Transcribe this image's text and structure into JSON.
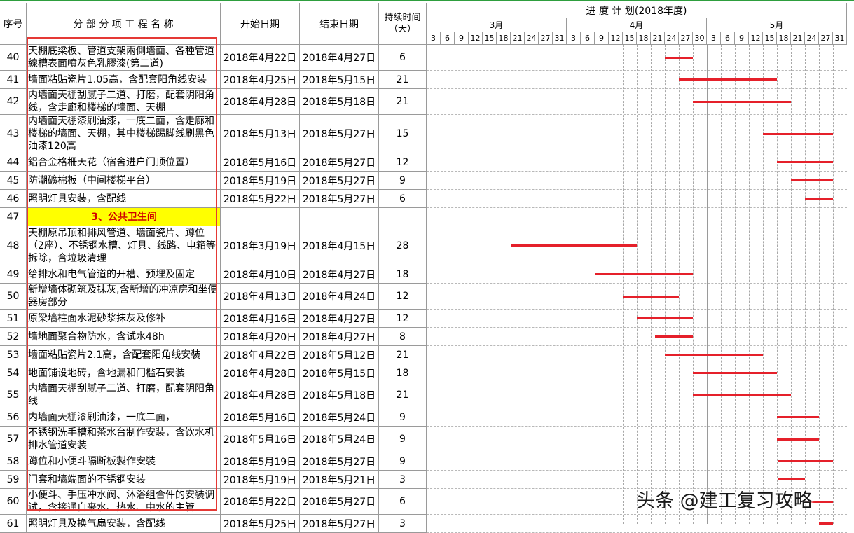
{
  "header": {
    "col_no": "序号",
    "col_name": "分 部 分 项 工 程 名 称",
    "col_start": "开始日期",
    "col_end": "结束日期",
    "col_duration": "持续时间（天）",
    "plan_title": "进 度 计 划(2018年度)",
    "months": [
      "3月",
      "4月",
      "5月"
    ],
    "days": [
      "3",
      "6",
      "9",
      "12",
      "15",
      "18",
      "21",
      "24",
      "27",
      "31",
      "3",
      "6",
      "9",
      "12",
      "15",
      "18",
      "21",
      "24",
      "27",
      "30",
      "3",
      "6",
      "9",
      "12",
      "15",
      "18",
      "21",
      "24",
      "27",
      "31"
    ]
  },
  "rows": [
    {
      "no": "40",
      "name": "天棚底梁板、管道支架兩側墻面、各種管道線槽表面噴灰色乳膠漆(第二道)",
      "start": "2018年4月22日",
      "end": "2018年4月27日",
      "duration": "6",
      "bar": [
        17,
        19
      ]
    },
    {
      "no": "41",
      "name": "墙面粘贴瓷片1.05高，含配套阳角线安装",
      "start": "2018年4月25日",
      "end": "2018年5月15日",
      "duration": "21",
      "bar": [
        18,
        25
      ]
    },
    {
      "no": "42",
      "name": "内墙面天棚刮腻子二道、打磨，配套阴阳角线，含走廊和楼梯的墙面、天棚",
      "start": "2018年4月28日",
      "end": "2018年5月18日",
      "duration": "21",
      "bar": [
        19,
        26
      ]
    },
    {
      "no": "43",
      "name": "内墙面天棚漆刷油漆，一底二面，含走廊和楼梯的墙面、天棚，其中楼梯踢脚线刷黑色油漆120高",
      "start": "2018年5月13日",
      "end": "2018年5月27日",
      "duration": "15",
      "bar": [
        24,
        29
      ]
    },
    {
      "no": "44",
      "name": "鋁合金格柵天花（宿舍进户门顶位置）",
      "start": "2018年5月16日",
      "end": "2018年5月27日",
      "duration": "12",
      "bar": [
        25,
        29
      ]
    },
    {
      "no": "45",
      "name": "防潮礦棉板（中间楼梯平台）",
      "start": "2018年5月19日",
      "end": "2018年5月27日",
      "duration": "9",
      "bar": [
        26,
        29
      ]
    },
    {
      "no": "46",
      "name": "照明灯具安装，含配线",
      "start": "2018年5月22日",
      "end": "2018年5月27日",
      "duration": "6",
      "bar": [
        27,
        29
      ]
    },
    {
      "no": "47",
      "name": "3、公共卫生间",
      "start": "",
      "end": "",
      "duration": "",
      "section": true
    },
    {
      "no": "48",
      "name": "天棚原吊顶和排风管道、墙面瓷片、蹲位（2座）、不锈钢水槽、灯具、线路、电箱等拆除，含垃圾清理",
      "start": "2018年3月19日",
      "end": "2018年4月15日",
      "duration": "28",
      "bar": [
        6,
        15
      ]
    },
    {
      "no": "49",
      "name": "给排水和电气管道的开槽、预埋及固定",
      "start": "2018年4月10日",
      "end": "2018年4月27日",
      "duration": "18",
      "bar": [
        12,
        19
      ]
    },
    {
      "no": "50",
      "name": "新增墙体砌筑及抹灰,含新增的冲凉房和坐便器房部分",
      "start": "2018年4月13日",
      "end": "2018年4月24日",
      "duration": "12",
      "bar": [
        14,
        18
      ]
    },
    {
      "no": "51",
      "name": "原梁墙柱面水泥砂浆抹灰及修补",
      "start": "2018年4月16日",
      "end": "2018年4月27日",
      "duration": "12",
      "bar": [
        15,
        19
      ]
    },
    {
      "no": "52",
      "name": "墙地面聚合物防水，含试水48h",
      "start": "2018年4月20日",
      "end": "2018年4月27日",
      "duration": "8",
      "bar": [
        16.3,
        19
      ]
    },
    {
      "no": "53",
      "name": "墙面粘贴瓷片2.1高，含配套阳角线安装",
      "start": "2018年4月22日",
      "end": "2018年5月12日",
      "duration": "21",
      "bar": [
        17,
        24
      ]
    },
    {
      "no": "54",
      "name": "地面铺设地砖，含地漏和门槛石安装",
      "start": "2018年4月28日",
      "end": "2018年5月15日",
      "duration": "18",
      "bar": [
        19,
        25
      ]
    },
    {
      "no": "55",
      "name": "内墙面天棚刮腻子二道、打磨，配套阴阳角线",
      "start": "2018年4月28日",
      "end": "2018年5月18日",
      "duration": "21",
      "bar": [
        19,
        26
      ]
    },
    {
      "no": "56",
      "name": "内墙面天棚漆刷油漆，一底二面，",
      "start": "2018年5月16日",
      "end": "2018年5月24日",
      "duration": "9",
      "bar": [
        25,
        28
      ]
    },
    {
      "no": "57",
      "name": "不锈钢洗手槽和茶水台制作安装，含饮水机排水管道安装",
      "start": "2018年5月16日",
      "end": "2018年5月24日",
      "duration": "9",
      "bar": [
        25,
        28
      ]
    },
    {
      "no": "58",
      "name": "蹲位和小便斗隔断板製作安裝",
      "start": "2018年5月19日",
      "end": "2018年5月27日",
      "duration": "9",
      "bar": [
        25.1,
        29
      ]
    },
    {
      "no": "59",
      "name": "门套和墙端面的不锈钢安装",
      "start": "2018年5月19日",
      "end": "2018年5月21日",
      "duration": "3",
      "bar": [
        25.1,
        27
      ]
    },
    {
      "no": "60",
      "name": "小便斗、手压冲水阀、沐浴组合件的安装调试，含接通自来水、热水、中水的主管",
      "start": "2018年5月22日",
      "end": "2018年5月27日",
      "duration": "6",
      "bar": [
        27,
        29
      ]
    },
    {
      "no": "61",
      "name": "照明灯具及换气扇安装，含配线",
      "start": "2018年5月25日",
      "end": "2018年5月27日",
      "duration": "3",
      "bar": [
        28,
        29
      ]
    }
  ],
  "watermark": "头条 @建工复习攻略"
}
